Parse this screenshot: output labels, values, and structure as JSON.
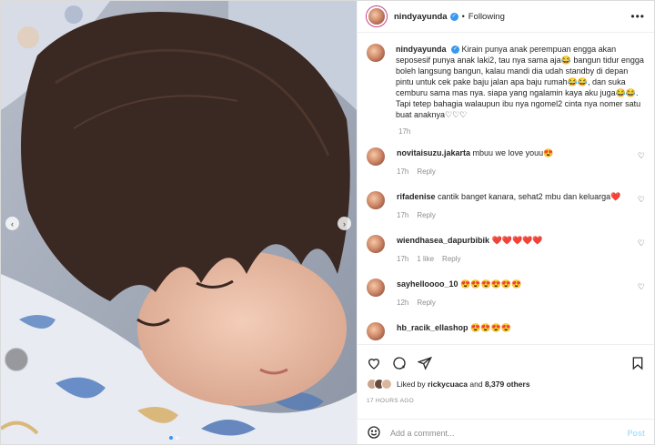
{
  "post": {
    "username": "nindyayunda",
    "follow_status": "Following",
    "caption": "Kirain punya anak perempuan engga akan seposesif punya anak laki2, tau nya sama aja😂 bangun tidur engga boleh langsung bangun, kalau mandi dia udah standby di depan pintu untuk cek pake baju jalan apa baju rumah😂😂, dan suka cemburu sama mas nya. siapa yang ngalamin kaya aku juga😂😂. Tapi tetep bahagia walaupun ibu nya ngomel2 cinta nya nomer satu buat anaknya♡♡♡",
    "caption_time": "17h"
  },
  "comments": [
    {
      "user": "novitaisuzu.jakarta",
      "text": "mbuu we love youu😍",
      "time": "17h",
      "likes": "",
      "reply": "Reply"
    },
    {
      "user": "rifadenise",
      "text": "cantik banget kanara, sehat2 mbu dan keluarga❤️",
      "time": "17h",
      "likes": "",
      "reply": "Reply"
    },
    {
      "user": "wiendhasea_dapurbibik",
      "text": "❤️❤️❤️❤️❤️",
      "time": "17h",
      "likes": "1 like",
      "reply": "Reply"
    },
    {
      "user": "sayhelloooo_10",
      "text": "😍😍😍😍😍😍",
      "time": "12h",
      "likes": "",
      "reply": "Reply"
    },
    {
      "user": "hb_racik_ellashop",
      "text": "😍😍😍😍",
      "time": "",
      "likes": "",
      "reply": ""
    }
  ],
  "likes": {
    "prefix": "Liked by",
    "user": "rickycuaca",
    "middle": "and",
    "others": "8,379 others"
  },
  "post_time": "17 HOURS AGO",
  "add_comment": {
    "placeholder": "Add a comment...",
    "post_label": "Post"
  },
  "icons": {
    "more": "more-options-icon",
    "like": "heart-icon",
    "comment": "comment-icon",
    "share": "share-icon",
    "save": "bookmark-icon",
    "emoji": "smiley-icon",
    "carousel_prev": "chevron-left-icon",
    "carousel_next": "chevron-right-icon"
  },
  "colors": {
    "link_blue": "#3897f0",
    "post_disabled": "#b2dffc",
    "muted": "#8e8e8e"
  }
}
